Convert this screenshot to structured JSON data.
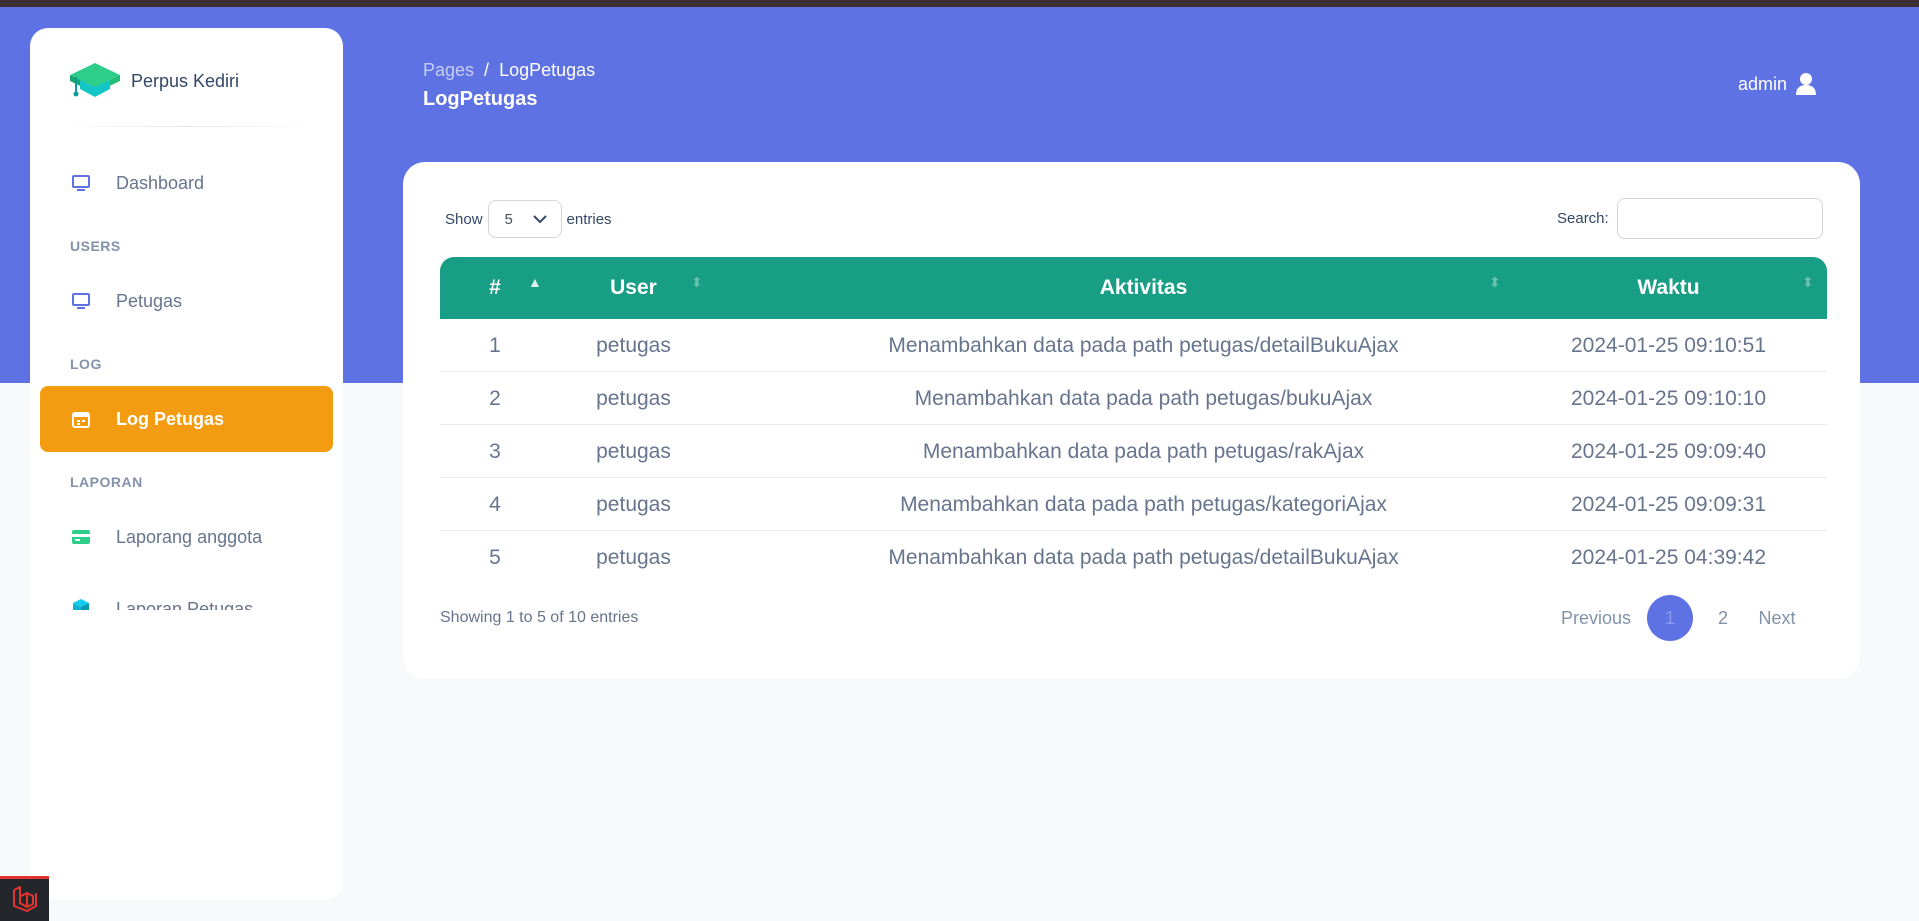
{
  "app": {
    "brand": "Perpus Kediri"
  },
  "sidebar": {
    "items": [
      {
        "label": "Dashboard"
      },
      {
        "label": "Petugas"
      },
      {
        "label": "Log Petugas"
      },
      {
        "label": "Laporang anggota"
      },
      {
        "label": "Laporan Petugas"
      }
    ],
    "headings": {
      "users": "USERS",
      "log": "LOG",
      "laporan": "LAPORAN"
    }
  },
  "header": {
    "breadcrumb": {
      "parent": "Pages",
      "separator": "/",
      "current": "LogPetugas"
    },
    "title": "LogPetugas",
    "user": "admin"
  },
  "table_controls": {
    "show_label": "Show",
    "entries_value": "5",
    "entries_label": "entries",
    "search_label": "Search:"
  },
  "table": {
    "columns": [
      "#",
      "User",
      "Aktivitas",
      "Waktu"
    ],
    "rows": [
      {
        "no": "1",
        "user": "petugas",
        "aktivitas": "Menambahkan data pada path petugas/detailBukuAjax",
        "waktu": "2024-01-25 09:10:51"
      },
      {
        "no": "2",
        "user": "petugas",
        "aktivitas": "Menambahkan data pada path petugas/bukuAjax",
        "waktu": "2024-01-25 09:10:10"
      },
      {
        "no": "3",
        "user": "petugas",
        "aktivitas": "Menambahkan data pada path petugas/rakAjax",
        "waktu": "2024-01-25 09:09:40"
      },
      {
        "no": "4",
        "user": "petugas",
        "aktivitas": "Menambahkan data pada path petugas/kategoriAjax",
        "waktu": "2024-01-25 09:09:31"
      },
      {
        "no": "5",
        "user": "petugas",
        "aktivitas": "Menambahkan data pada path petugas/detailBukuAjax",
        "waktu": "2024-01-25 04:39:42"
      }
    ]
  },
  "footer": {
    "info": "Showing 1 to 5 of 10 entries",
    "pagination": {
      "previous": "Previous",
      "pages": [
        "1",
        "2"
      ],
      "next": "Next"
    }
  },
  "colors": {
    "banner": "#5e72e4",
    "active_nav": "#f39c12",
    "table_header": "#189e85",
    "brand_icon": "#2dce89"
  },
  "icons": {
    "brand": "graduation-cap-icon",
    "dashboard": "desktop-icon",
    "petugas": "desktop-icon",
    "log": "calendar-icon",
    "laporan_anggota": "credit-card-icon",
    "laporan_petugas": "box-icon",
    "user": "user-icon",
    "select": "chevron-down-icon"
  }
}
